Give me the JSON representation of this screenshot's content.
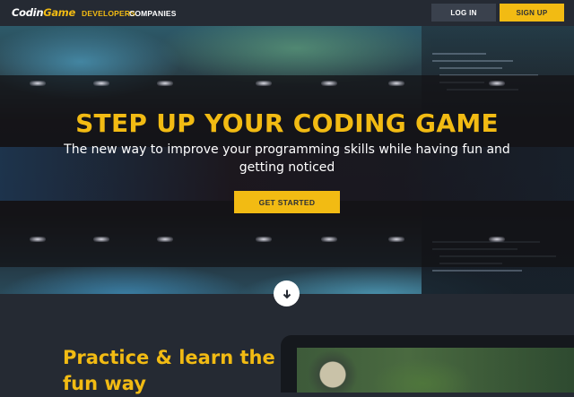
{
  "nav": {
    "logo_main": "Codin",
    "logo_accent": "Game",
    "developers": "DEVELOPERS",
    "companies": "COMPANIES",
    "login": "LOG IN",
    "signup": "SIGN UP"
  },
  "hero": {
    "title": "STEP UP YOUR CODING GAME",
    "subtitle": "The new way to improve your programming skills while having fun and getting noticed",
    "cta": "GET STARTED"
  },
  "section": {
    "title": "Practice & learn the fun way"
  },
  "icons": {
    "scroll": "arrow-down-icon"
  },
  "colors": {
    "accent": "#f2bb13",
    "background": "#252a33",
    "login_button": "#3a414d"
  }
}
